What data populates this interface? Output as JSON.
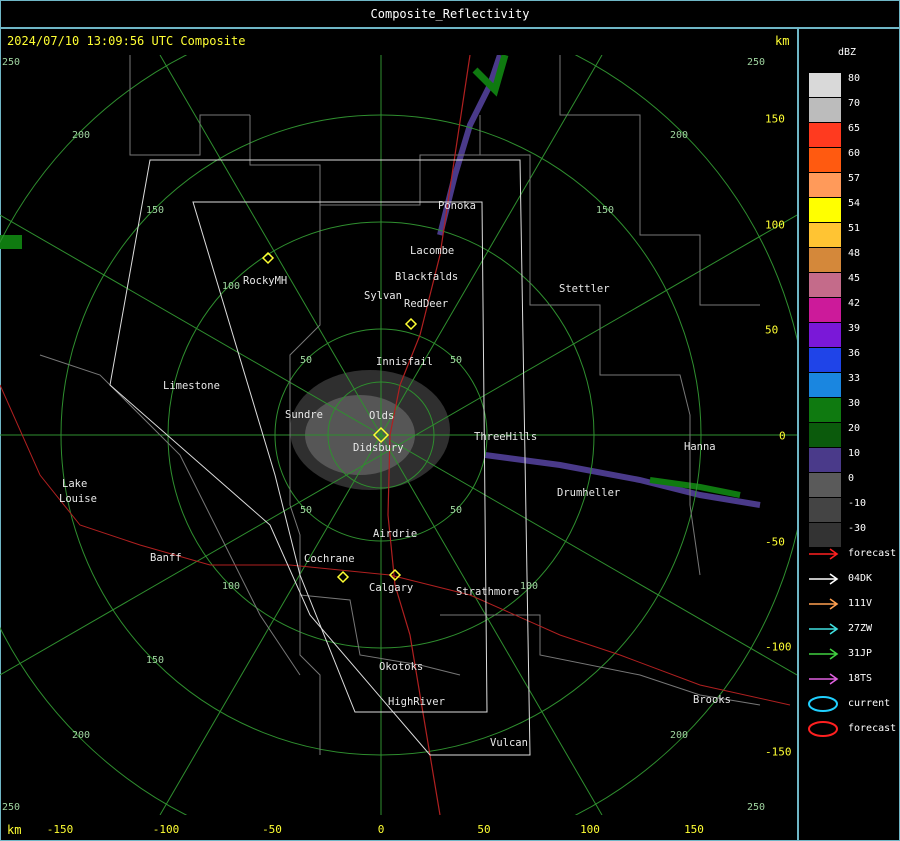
{
  "title": "Composite_Reflectivity",
  "header": "2024/07/10 13:09:56 UTC Composite",
  "units": {
    "top": "km",
    "bottom": "km"
  },
  "x_ticks": [
    "-150",
    "-100",
    "-50",
    "0",
    "50",
    "100",
    "150"
  ],
  "y_ticks": [
    "150",
    "100",
    "50",
    "0",
    "-50",
    "-100",
    "-150"
  ],
  "range_ring_labels": [
    "50",
    "100",
    "150",
    "200",
    "250"
  ],
  "towns": [
    {
      "key": "ponoka",
      "name": "Ponoka"
    },
    {
      "key": "lacombe",
      "name": "Lacombe"
    },
    {
      "key": "blackfalds",
      "name": "Blackfalds"
    },
    {
      "key": "rockymh",
      "name": "RockyMH"
    },
    {
      "key": "sylvan",
      "name": "Sylvan"
    },
    {
      "key": "reddeer",
      "name": "RedDeer"
    },
    {
      "key": "stettler",
      "name": "Stettler"
    },
    {
      "key": "innisfail",
      "name": "Innisfail"
    },
    {
      "key": "limestone",
      "name": "Limestone"
    },
    {
      "key": "sundre",
      "name": "Sundre"
    },
    {
      "key": "olds",
      "name": "Olds"
    },
    {
      "key": "didsbury",
      "name": "Didsbury"
    },
    {
      "key": "threehills",
      "name": "ThreeHills"
    },
    {
      "key": "hanna",
      "name": "Hanna"
    },
    {
      "key": "lake",
      "name": "Lake"
    },
    {
      "key": "louise",
      "name": "Louise"
    },
    {
      "key": "drumheller",
      "name": "Drumheller"
    },
    {
      "key": "airdrie",
      "name": "Airdrie"
    },
    {
      "key": "banff",
      "name": "Banff"
    },
    {
      "key": "cochrane",
      "name": "Cochrane"
    },
    {
      "key": "calgary",
      "name": "Calgary"
    },
    {
      "key": "strathmore",
      "name": "Strathmore"
    },
    {
      "key": "okotoks",
      "name": "Okotoks"
    },
    {
      "key": "highriver",
      "name": "HighRiver"
    },
    {
      "key": "brooks",
      "name": "Brooks"
    },
    {
      "key": "vulcan",
      "name": "Vulcan"
    }
  ],
  "legend": {
    "title": "dBZ",
    "scale": [
      {
        "label": "80",
        "color": "#d9d9d9"
      },
      {
        "label": "70",
        "color": "#bcbcbc"
      },
      {
        "label": "65",
        "color": "#ff3a1f"
      },
      {
        "label": "60",
        "color": "#ff5a10"
      },
      {
        "label": "57",
        "color": "#ff9a5a"
      },
      {
        "label": "54",
        "color": "#ffff00"
      },
      {
        "label": "51",
        "color": "#ffc433"
      },
      {
        "label": "48",
        "color": "#d4883a"
      },
      {
        "label": "45",
        "color": "#c46b8a"
      },
      {
        "label": "42",
        "color": "#cc1a9a"
      },
      {
        "label": "39",
        "color": "#7a18d8"
      },
      {
        "label": "36",
        "color": "#1f44e8"
      },
      {
        "label": "33",
        "color": "#1a86e0"
      },
      {
        "label": "30",
        "color": "#0f7a10"
      },
      {
        "label": "20",
        "color": "#0b5a0c"
      },
      {
        "label": "10",
        "color": "#4a3a8a"
      },
      {
        "label": "0",
        "color": "#5a5a5a"
      },
      {
        "label": "-10",
        "color": "#444444"
      },
      {
        "label": "-30",
        "color": "#333333"
      }
    ],
    "tracks": [
      {
        "label": "forecast",
        "color": "#ff2020",
        "kind": "arrow"
      },
      {
        "label": "04DK",
        "color": "#ffffff",
        "kind": "arrow"
      },
      {
        "label": "111V",
        "color": "#ffa050",
        "kind": "arrow"
      },
      {
        "label": "27ZW",
        "color": "#40e0e0",
        "kind": "arrow"
      },
      {
        "label": "31JP",
        "color": "#40d040",
        "kind": "arrow"
      },
      {
        "label": "18TS",
        "color": "#e060e0",
        "kind": "arrow"
      },
      {
        "label": "current",
        "color": "#20d0ff",
        "kind": "ellipse"
      },
      {
        "label": "forecast",
        "color": "#ff2020",
        "kind": "ellipse"
      }
    ]
  }
}
